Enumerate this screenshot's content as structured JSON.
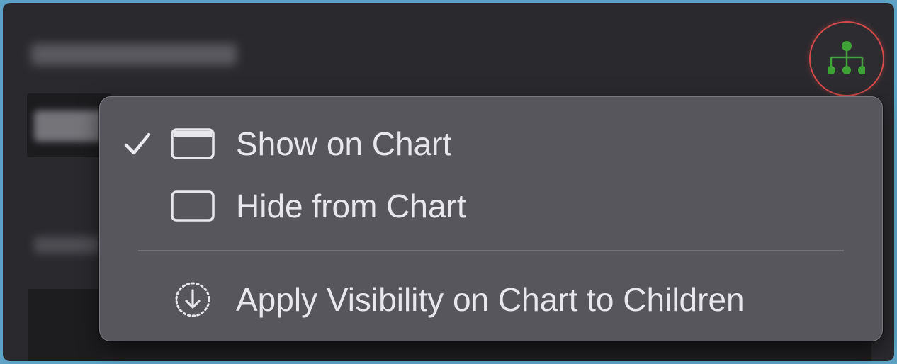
{
  "toolbar": {
    "hierarchy_button": {
      "icon": "hierarchy-tree-icon",
      "color": "#3fa236",
      "highlight": "#d14a4a"
    }
  },
  "menu": {
    "items": [
      {
        "label": "Show on Chart",
        "checked": true,
        "icon": "window-visible-icon"
      },
      {
        "label": "Hide from Chart",
        "checked": false,
        "icon": "window-hidden-icon"
      },
      {
        "label": "Apply Visibility on Chart to Children",
        "checked": false,
        "icon": "apply-to-children-icon"
      }
    ],
    "check_glyph": "✓"
  },
  "colors": {
    "menu_bg": "#56565c",
    "window_bg": "#2a2a2e",
    "desktop_bg": "#5ea3c6",
    "text": "#e8e8ec"
  }
}
